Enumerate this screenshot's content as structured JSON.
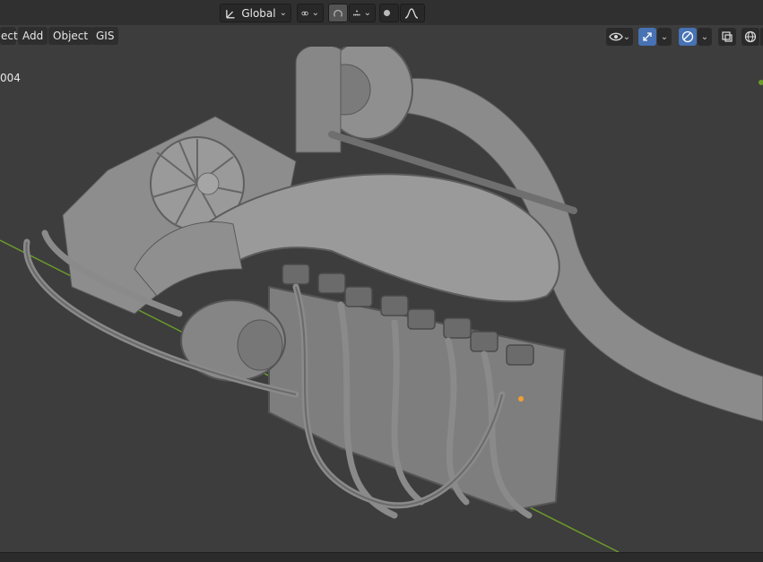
{
  "header": {
    "transform_orientation": "Global",
    "pivot_icon": "pivot-icon",
    "snap_icon": "snap-icon",
    "proportional_icon": "proportional-edit-icon"
  },
  "menu": {
    "object_partial": "ect",
    "add": "Add",
    "object": "Object",
    "gis": "GIS"
  },
  "viewport": {
    "overlay_label": "004",
    "model": "engine-model"
  },
  "colors": {
    "background": "#3d3d3d",
    "header": "#303030",
    "accent": "#4772b3",
    "grid_axis": "#6a9a2a",
    "model_gray": "#8a8a8a"
  }
}
